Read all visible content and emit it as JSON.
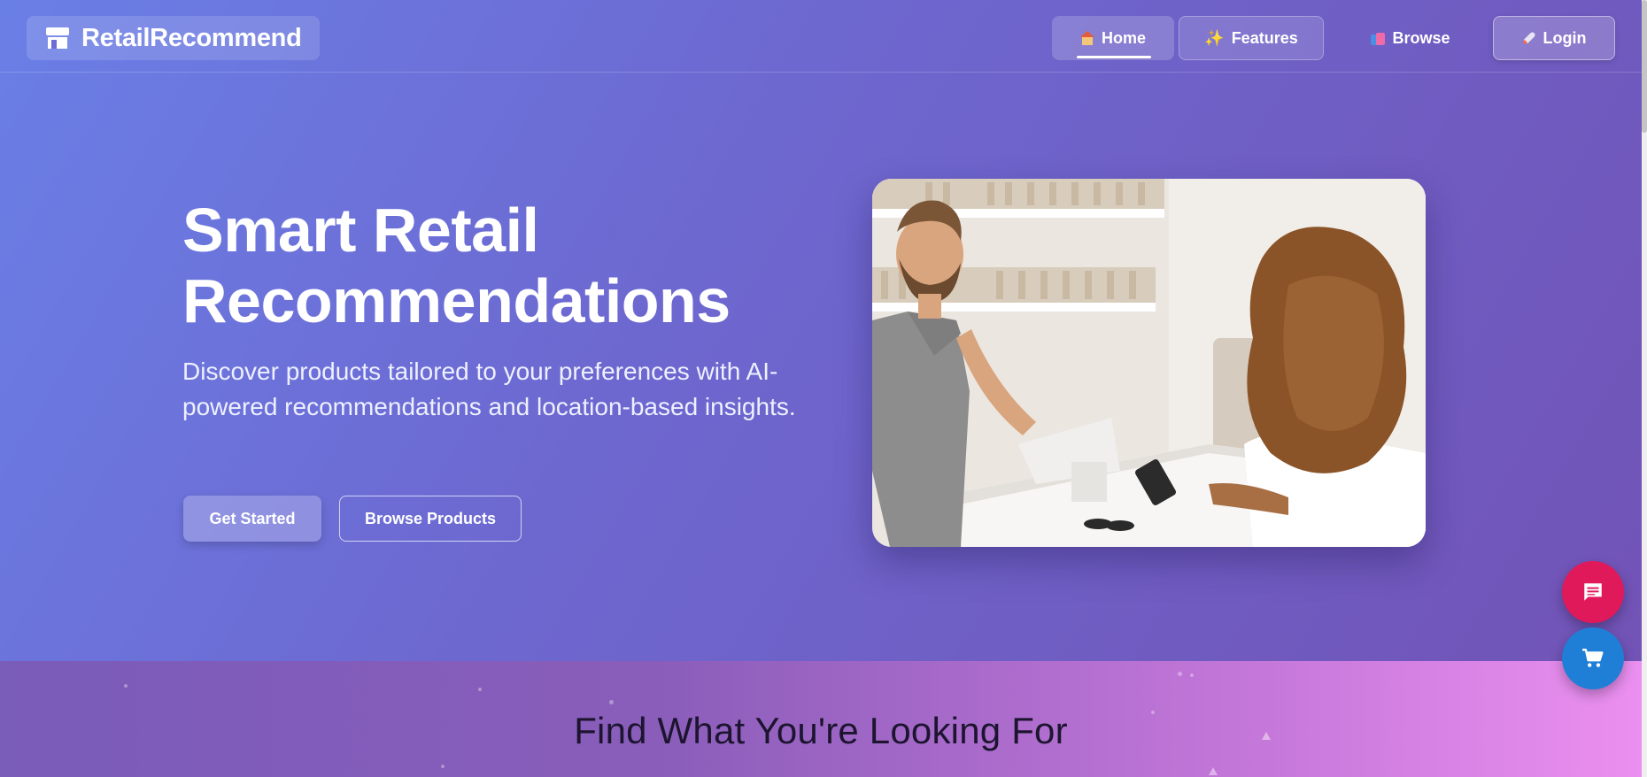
{
  "header": {
    "brand": "RetailRecommend",
    "nav": [
      {
        "label": "Home",
        "icon": "house-icon",
        "active": true
      },
      {
        "label": "Features",
        "icon": "sparkles-icon",
        "active": false
      },
      {
        "label": "Browse",
        "icon": "shopping-bags-icon",
        "active": false
      },
      {
        "label": "Login",
        "icon": "rocket-icon",
        "active": false
      }
    ]
  },
  "hero": {
    "title_line1": "Smart Retail",
    "title_line2": "Recommendations",
    "subtitle": "Discover products tailored to your preferences with AI-powered recommendations and location-based insights.",
    "primary_button": "Get Started",
    "secondary_button": "Browse Products",
    "image": "shopper paying at checkout counter"
  },
  "section": {
    "title": "Find What You're Looking For"
  },
  "fabs": [
    {
      "icon": "chat-icon",
      "color": "#e0195a"
    },
    {
      "icon": "cart-icon",
      "color": "#1f7fd6"
    }
  ],
  "colors": {
    "hero_gradient_start": "#6a7fe6",
    "hero_gradient_end": "#7252b5",
    "band_gradient_end": "#eb8ff0"
  }
}
